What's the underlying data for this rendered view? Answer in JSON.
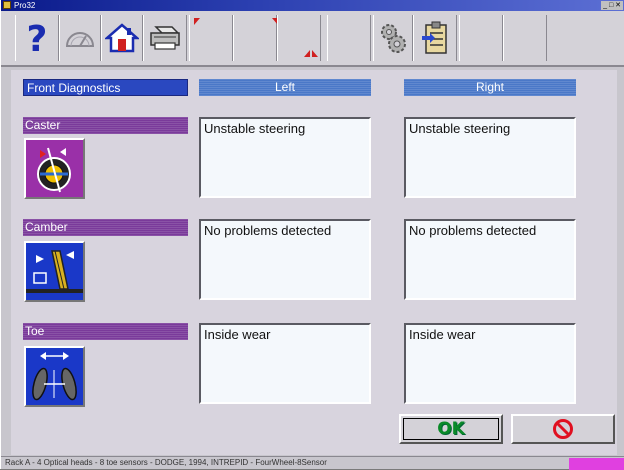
{
  "window": {
    "title": "Pro32"
  },
  "toolbar": {
    "buttons": [
      {
        "name": "help",
        "icon": "question-icon"
      },
      {
        "name": "gauge",
        "icon": "gauge-icon"
      },
      {
        "name": "home",
        "icon": "home-icon"
      },
      {
        "name": "print",
        "icon": "printer-icon"
      },
      {
        "name": "empty-1",
        "icon": ""
      },
      {
        "name": "empty-2",
        "icon": ""
      },
      {
        "name": "empty-3",
        "icon": ""
      },
      {
        "name": "settings",
        "icon": "gears-icon"
      },
      {
        "name": "clipboard",
        "icon": "clipboard-icon"
      },
      {
        "name": "empty-4",
        "icon": ""
      },
      {
        "name": "empty-5",
        "icon": ""
      }
    ]
  },
  "headers": {
    "section": "Front Diagnostics",
    "left": "Left",
    "right": "Right"
  },
  "rows": [
    {
      "label": "Caster",
      "icon": "caster-icon",
      "left": "Unstable steering",
      "right": "Unstable steering"
    },
    {
      "label": "Camber",
      "icon": "camber-icon",
      "left": "No problems detected",
      "right": "No problems detected"
    },
    {
      "label": "Toe",
      "icon": "toe-icon",
      "left": "Inside wear",
      "right": "Inside wear"
    }
  ],
  "buttons": {
    "ok": "OK",
    "cancel_icon": "cancel-icon"
  },
  "status": "Rack A - 4 Optical heads - 8 toe sensors - DODGE, 1994, INTREPID - FourWheel-8Sensor",
  "colors": {
    "header_blue": "#4a78c8",
    "header_purple": "#7a3a9a",
    "ok_green": "#0a8a28",
    "cancel_red": "#e01020",
    "status_accent": "#e040e0"
  }
}
